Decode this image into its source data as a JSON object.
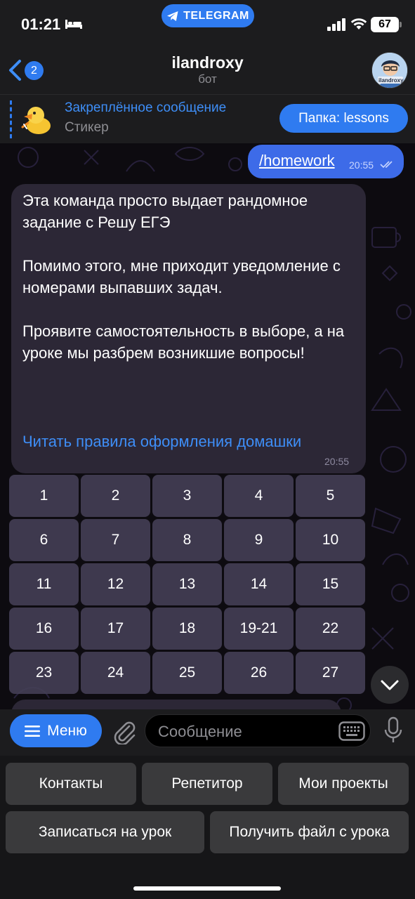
{
  "status_bar": {
    "time": "01:21",
    "app_pill": "TELEGRAM",
    "battery": "67"
  },
  "header": {
    "back_badge": "2",
    "title": "ilandroxy",
    "subtitle": "бот",
    "avatar_caption": "ilandroxy"
  },
  "pinned": {
    "title": "Закреплённое сообщение",
    "subtitle": "Стикер",
    "folder_button": "Папка: lessons"
  },
  "chat": {
    "outgoing": {
      "text": "/homework",
      "time": "20:55"
    },
    "incoming": {
      "paragraphs": [
        "Эта команда просто выдает рандомное задание с Решу ЕГЭ",
        "Помимо этого, мне приходит уведомление с номерами выпавших задач.",
        "Проявите самостоятельность в выборе, а на уроке мы разбрем возникшие вопросы!"
      ],
      "link": "Читать правила оформления домашки",
      "time": "20:55"
    },
    "inline_keyboard": [
      [
        "1",
        "2",
        "3",
        "4",
        "5"
      ],
      [
        "6",
        "7",
        "8",
        "9",
        "10"
      ],
      [
        "11",
        "12",
        "13",
        "14",
        "15"
      ],
      [
        "16",
        "17",
        "18",
        "19-21",
        "22"
      ],
      [
        "23",
        "24",
        "25",
        "26",
        "27"
      ]
    ]
  },
  "input_bar": {
    "menu_label": "Меню",
    "placeholder": "Сообщение"
  },
  "reply_keyboard": {
    "row1": [
      "Контакты",
      "Репетитор",
      "Мои проекты"
    ],
    "row2": [
      "Записаться на урок",
      "Получить файл с урока"
    ]
  },
  "colors": {
    "accent": "#2f7bf0",
    "link": "#3e8ef7",
    "outgoing_bubble": "#3d6be8",
    "incoming_bubble": "#2c2736",
    "bar_bg": "#1c1c1e"
  }
}
